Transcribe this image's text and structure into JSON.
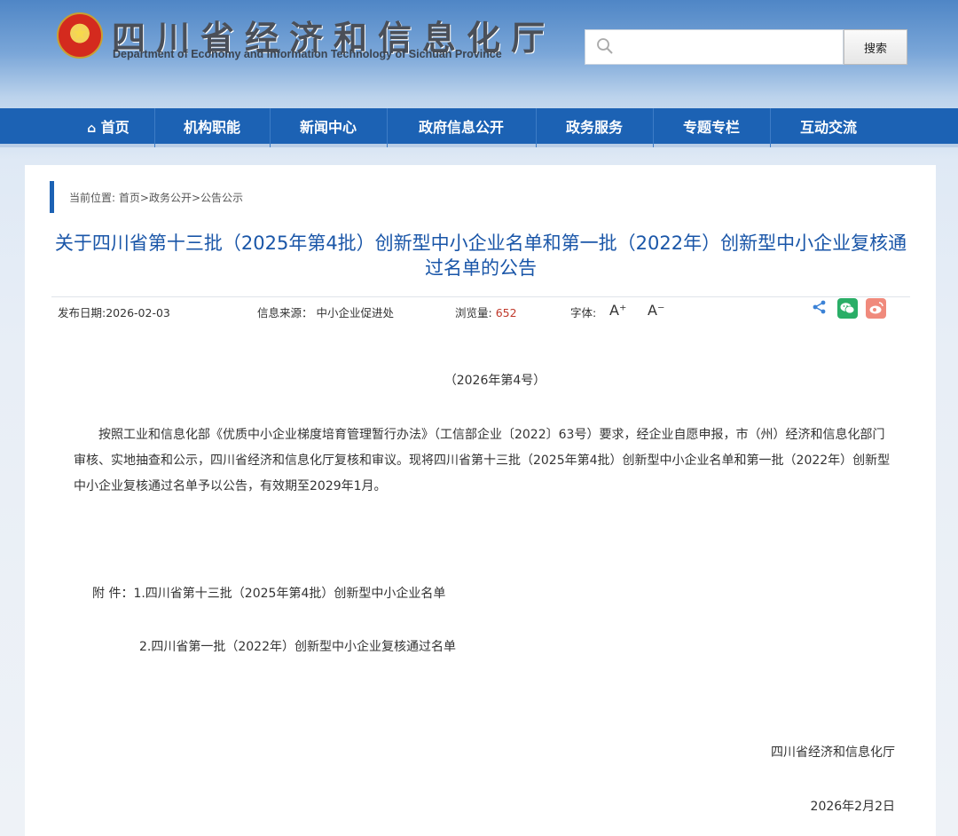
{
  "header": {
    "title": "四川省经济和信息化厅",
    "subtitle": "Department of Economy and Information Technology of Sichuan Province",
    "search": {
      "placeholder": "",
      "value": "",
      "button_label": "搜索"
    }
  },
  "nav": {
    "items": [
      {
        "label": "首页",
        "icon": "home-icon"
      },
      {
        "label": "机构职能"
      },
      {
        "label": "新闻中心"
      },
      {
        "label": "政府信息公开"
      },
      {
        "label": "政务服务"
      },
      {
        "label": "专题专栏"
      },
      {
        "label": "互动交流"
      }
    ]
  },
  "breadcrumb": {
    "prefix": "当前位置:",
    "items": [
      "首页",
      "政务公开",
      "公告公示"
    ],
    "separator": ">"
  },
  "article": {
    "title": "关于四川省第十三批（2025年第4批）创新型中小企业名单和第一批（2022年）创新型中小企业复核通过名单的公告",
    "meta": {
      "date_label": "发布日期:",
      "date": "2026-02-03",
      "source_label": "信息来源：",
      "source": "中小企业促进处",
      "views_label": "浏览量:",
      "views": "652",
      "font_label": "字体:",
      "font_increase": "A⁺",
      "font_decrease": "A⁻"
    },
    "doc_number": "（2026年第4号）",
    "body": "按照工业和信息化部《优质中小企业梯度培育管理暂行办法》（工信部企业〔2022〕63号）要求，经企业自愿申报，市（州）经济和信息化部门审核、实地抽查和公示，四川省经济和信息化厅复核和审议。现将四川省第十三批（2025年第4批）创新型中小企业名单和第一批（2022年）创新型中小企业复核通过名单予以公告，有效期至2029年1月。",
    "attachments_label": "附  件：",
    "attachments": [
      "1.四川省第十三批（2025年第4批）创新型中小企业名单",
      "2.四川省第一批（2022年）创新型中小企业复核通过名单"
    ],
    "signature": "四川省经济和信息化厅",
    "sign_date": "2026年2月2日"
  },
  "colors": {
    "nav_bg": "#1c62b4",
    "title": "#1a56a8",
    "views": "#c0392b",
    "wechat": "#2aae67",
    "weibo": "#f08a7c"
  },
  "icons": [
    "search-icon",
    "home-icon",
    "share-icon",
    "wechat-icon",
    "weibo-icon"
  ]
}
